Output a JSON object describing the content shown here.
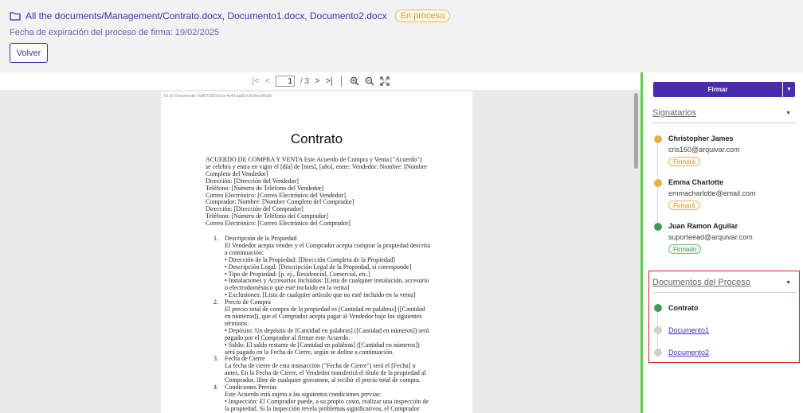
{
  "header": {
    "path": "All the documents/Management/Contrato.docx, Documento1.docx, Documento2.docx",
    "status_badge": "En proceso",
    "expiration": "Fecha de expiración del proceso de firma: 19/02/2025",
    "back_label": "Volver"
  },
  "viewer": {
    "toolbar": {
      "first_icon": "|<",
      "prev_icon": "<",
      "current_page": "1",
      "page_total": "/ 3",
      "next_icon": ">",
      "last_icon": ">|",
      "zoom_in_icon": "zoom-in",
      "zoom_out_icon": "zoom-out",
      "fullscreen_icon": "fullscreen"
    },
    "document": {
      "doc_id": "ID do Documento: 9d457220-6a1a-4c49-aa93-e3c9eac6fa2b",
      "title": "Contrato",
      "intro_lines": [
        "ACUERDO DE COMPRA Y VENTA Este Acuerdo de Compra y Venta (\"Acuerdo\")",
        "se celebra y entra en vigor el [día] de [mes], [año], entre: Vendedor: Nombre: [Nombre",
        "Completo del Vendedor]",
        "Dirección: [Dirección del Vendedor]",
        "Teléfono: [Número de Teléfono del Vendedor]",
        "Correo Electrónico: [Correo Electrónico del Vendedor]",
        "Comprador: Nombre: [Nombre Completo del Comprador]",
        "Dirección: [Dirección del Comprador]",
        "Teléfono: [Número de Teléfono del Comprador]",
        "Correo Electrónico: [Correo Electrónico del Comprador]"
      ],
      "sections": [
        {
          "num": "1.",
          "lines": [
            "Descripción de la Propiedad",
            "El Vendedor acepta vender y el Comprador acepta comprar la propiedad descrita",
            "a continuación:",
            "• Dirección de la Propiedad: [Dirección Completa de la Propiedad]",
            "• Descripción Legal: [Descripción Legal de la Propiedad, si corresponde]",
            "• Tipo de Propiedad: [p. ej., Residencial, Comercial, etc.]",
            "• Instalaciones y Accesorios Incluidos: [Lista de cualquier instalación, accesorio",
            "o electrodoméstico que esté incluido en la venta]",
            "• Exclusiones: [Lista de cualquier artículo que no esté incluido en la venta]"
          ]
        },
        {
          "num": "2.",
          "lines": [
            "Precio de Compra",
            "El precio total de compra de la propiedad es [Cantidad en palabras] ([Cantidad",
            "en números]), que el Comprador acepta pagar al Vendedor bajo los siguientes",
            "términos:",
            "• Depósito: Un depósito de [Cantidad en palabras] ([Cantidad en números]) será",
            "pagado por el Comprador al firmar este Acuerdo.",
            "• Saldo: El saldo restante de [Cantidad en palabras] ([Cantidad en números])",
            "será pagado en la Fecha de Cierre, según se define a continuación."
          ]
        },
        {
          "num": "3.",
          "lines": [
            "Fecha de Cierre",
            "La fecha de cierre de esta transacción (\"Fecha de Cierre\") será el [Fecha] o",
            "antes. En la Fecha de Cierre, el Vendedor transferirá el título de la propiedad al",
            "Comprador, libre de cualquier gravamen, al recibir el precio total de compra."
          ]
        },
        {
          "num": "4.",
          "lines": [
            "Condiciones Previas",
            "Este Acuerdo está sujeto a las siguientes condiciones previas:",
            "• Inspección: El Comprador puede, a su propio costo, realizar una inspección de",
            "la propiedad. Si la inspección revela problemas significativos, el Comprador"
          ]
        }
      ]
    }
  },
  "panel": {
    "sign_label": "Firmar",
    "signers_title": "Signatarios",
    "signers": [
      {
        "name": "Christopher James",
        "email": "cris160@arquivar.com",
        "status": "Firmará",
        "state": "pending"
      },
      {
        "name": "Emma Charlotte",
        "email": "emmacharlotte@email.com",
        "status": "Firmará",
        "state": "pending"
      },
      {
        "name": "Juan Ramon Aguilar",
        "email": "suporteead@arquivar.com",
        "status": "Firmado",
        "state": "signed"
      }
    ],
    "documents_title": "Documentos del Proceso",
    "documents": [
      {
        "label": "Contrato",
        "state": "active"
      },
      {
        "label": "Documento1",
        "state": "link"
      },
      {
        "label": "Documento2",
        "state": "link"
      }
    ]
  },
  "colors": {
    "brand": "#4a2bb0",
    "pending": "#e3b24a",
    "signed": "#3f9a58",
    "divider": "#5fd14a",
    "highlight_box": "#e02020"
  }
}
